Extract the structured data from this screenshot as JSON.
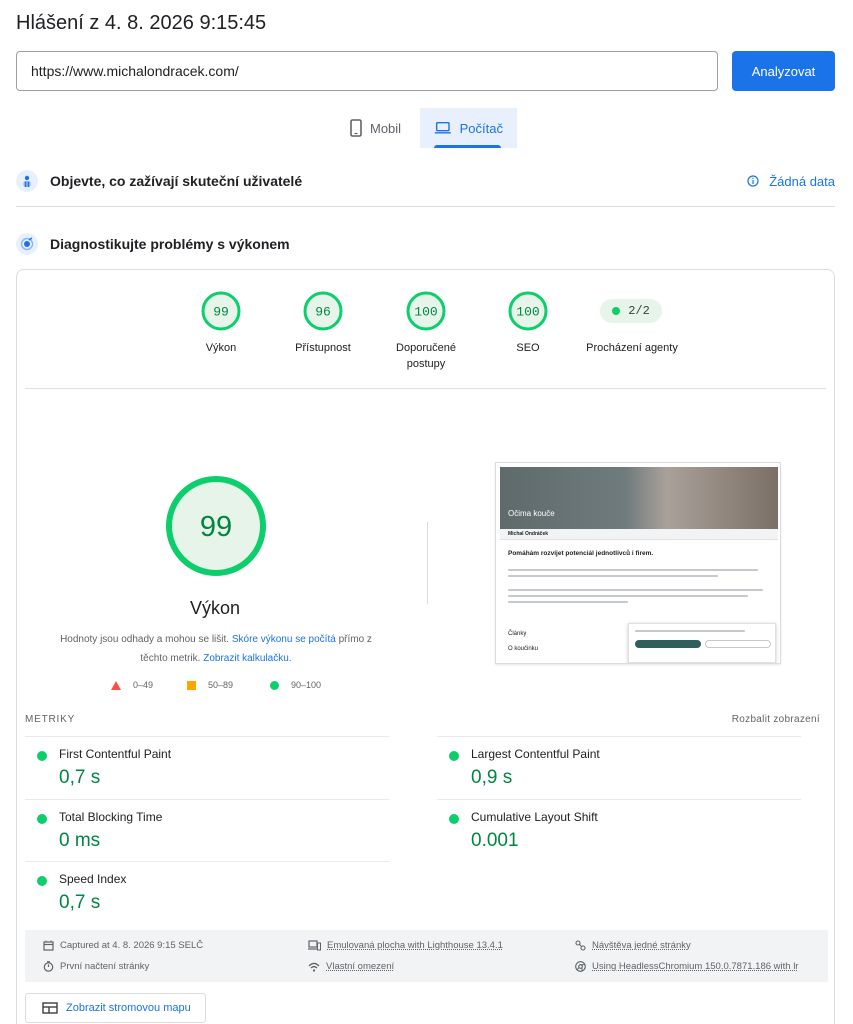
{
  "header": {
    "title": "Hlášení z 4. 8. 2026 9:15:45"
  },
  "search": {
    "url": "https://www.michalondracek.com/",
    "analyze_label": "Analyzovat"
  },
  "device_tabs": {
    "mobile": "Mobil",
    "desktop": "Počítač",
    "selected": "desktop"
  },
  "field_data": {
    "title": "Objevte, co zažívají skuteční uživatelé",
    "status": "Žádná data"
  },
  "lab": {
    "title": "Diagnostikujte problémy s výkonem"
  },
  "scores": [
    {
      "label": "Výkon",
      "value": "99"
    },
    {
      "label": "Přístupnost",
      "value": "96"
    },
    {
      "label": "Doporučené postupy",
      "value": "100"
    },
    {
      "label": "SEO",
      "value": "100"
    }
  ],
  "agent": {
    "value": "2/2",
    "label": "Procházení agenty"
  },
  "main_gauge": {
    "value": "99",
    "label": "Výkon",
    "disclaimer_1": "Hodnoty jsou odhady a mohou se lišit.",
    "disclaimer_link_1": "Skóre výkonu se počítá",
    "disclaimer_2": "přímo z těchto metrik.",
    "disclaimer_link_2": "Zobrazit kalkulačku."
  },
  "legend": {
    "poor": "0–49",
    "average": "50–89",
    "good": "90–100"
  },
  "screenshot": {
    "hero_text": "Očima kouče",
    "site_name": "Michal Ondráček",
    "headline": "Pomáhám rozvíjet potenciál jednotlivců i firem.",
    "articles": "Články",
    "about": "O koučinku"
  },
  "metrics": {
    "heading": "METRIKY",
    "expand": "Rozbalit zobrazení",
    "items": [
      {
        "name": "First Contentful Paint",
        "value": "0,7 s"
      },
      {
        "name": "Largest Contentful Paint",
        "value": "0,9 s"
      },
      {
        "name": "Total Blocking Time",
        "value": "0 ms"
      },
      {
        "name": "Cumulative Layout Shift",
        "value": "0.001"
      },
      {
        "name": "Speed Index",
        "value": "0,7 s"
      }
    ]
  },
  "footer": {
    "captured": "Captured at 4. 8. 2026 9:15 SELČ",
    "first_load": "První načtení stránky",
    "emulated": "Emulovaná plocha with Lighthouse 13.4.1",
    "throttling": "Vlastní omezení",
    "single_visit": "Návštěva jedné stránky",
    "browser": "Using HeadlessChromium 150.0.7871.186 with lr"
  },
  "treemap": {
    "label": "Zobrazit stromovou mapu"
  },
  "colors": {
    "good": "#0cce6b",
    "good_text": "#018642",
    "accent": "#1a73e8",
    "average": "#ffa400",
    "poor": "#ff4e42"
  }
}
